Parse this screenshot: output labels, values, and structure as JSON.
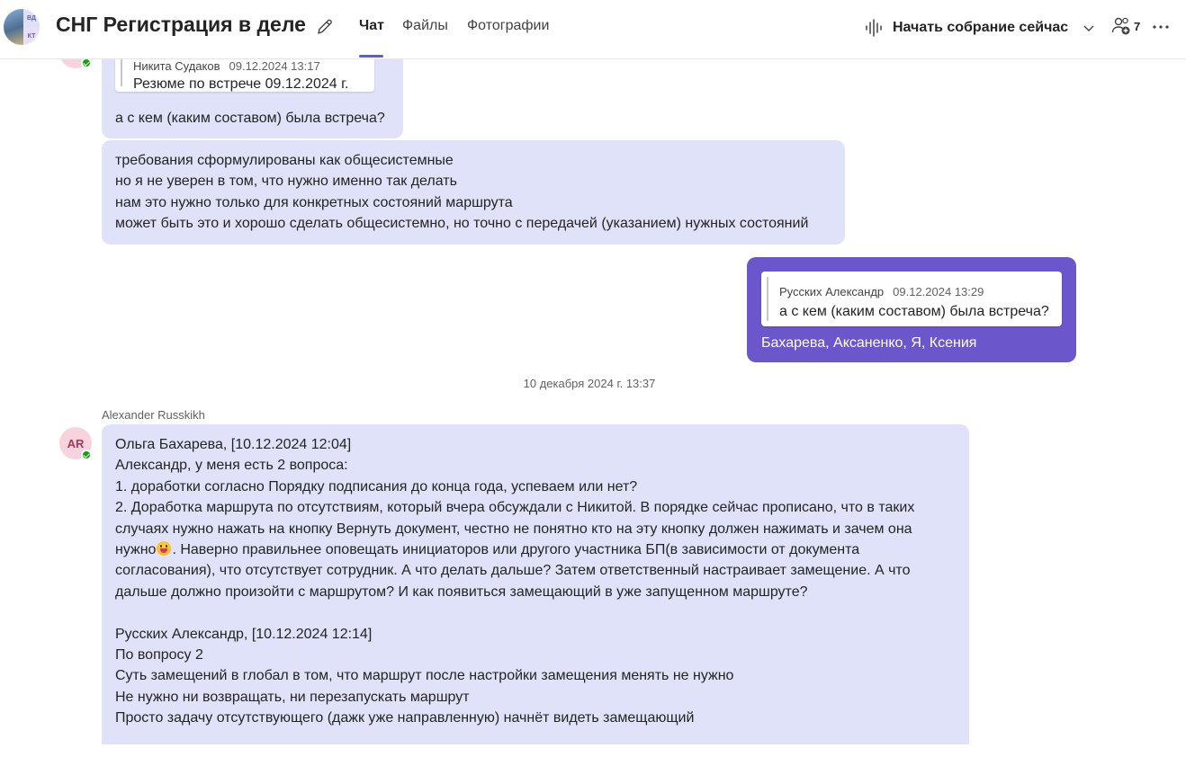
{
  "header": {
    "group_initials_top": "ВД",
    "group_initials_bottom": "КТ",
    "title": "СНГ Регистрация в деле",
    "tabs": [
      {
        "label": "Чат",
        "active": true
      },
      {
        "label": "Файлы",
        "active": false
      },
      {
        "label": "Фотографии",
        "active": false
      }
    ],
    "meet_now_label": "Начать собрание сейчас",
    "participants_count": "7",
    "accent_color": "#5b5fc7"
  },
  "messages": [
    {
      "quote": {
        "author": "Никита Судаков",
        "time": "09.12.2024 13:17",
        "text": "Резюме по встрече 09.12.2024 г."
      },
      "text": "а с кем (каким составом) была встреча?"
    },
    {
      "lines": [
        "требования сформулированы как общесистемные",
        "но я не уверен в том, что нужно именно так делать",
        "нам это нужно только для конкретных состояний маршрута",
        "может быть это и хорошо сделать общесистемно, но точно с передачей (указанием) нужных состояний"
      ]
    },
    {
      "mine": true,
      "quote": {
        "author": "Русских Александр",
        "time": "09.12.2024 13:29",
        "text": "а с кем (каким составом) была встреча?"
      },
      "text": "Бахарева, Аксаненко, Я, Ксения",
      "bubble_color": "#6b56cb"
    }
  ],
  "date_separator": "10 декабря 2024 г. 13:37",
  "long_message": {
    "sender": "Alexander Russkikh",
    "avatar_initials": "AR",
    "line1": "Ольга Бахарева, [10.12.2024 12:04]",
    "line2": "Александр, у меня есть 2 вопроса:",
    "line3": "1. доработки согласно Порядку подписания до конца года, успеваем или нет?",
    "line4": "2. Доработка маршрута по отсутствиям, который вчера обсуждали с Никитой. В порядке сейчас прописано, что в таких",
    "line5": "случаях нужно нажать на кнопку Вернуть документ, честно не понятно кто на эту кнопку должен нажимать и зачем она",
    "line6a": "нужно",
    "line6b": ". Наверно правильнее оповещать инициаторов или другого участника БП(в зависимости от документа",
    "line7": "согласования), что отсутствует сотрудник. А что делать дальше? Затем ответственный настраивает замещение. А что",
    "line8": "дальше должно произойти с маршрутом? И как появиться замещающий в уже запущенном маршруте?",
    "line9": "Русских Александр, [10.12.2024 12:14]",
    "line10": "По вопросу 2",
    "line11": "Суть замещений в глобал в том, что маршрут после настройки замещения менять не нужно",
    "line12": "Не нужно ни возвращать, ни перезапускать маршрут",
    "line13": "Просто задачу отсутствующего (дажк уже направленную) начнёт видеть замещающий"
  }
}
